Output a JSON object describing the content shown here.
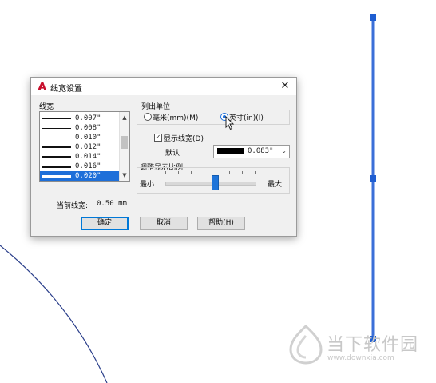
{
  "dialog": {
    "title": "线宽设置",
    "close_label": "✕",
    "lineweights_label": "线宽",
    "lineweights": [
      {
        "label": "0.007\"",
        "weight": 1
      },
      {
        "label": "0.008\"",
        "weight": 1
      },
      {
        "label": "0.010\"",
        "weight": 1
      },
      {
        "label": "0.012\"",
        "weight": 2
      },
      {
        "label": "0.014\"",
        "weight": 2
      },
      {
        "label": "0.016\"",
        "weight": 3
      },
      {
        "label": "0.020\"",
        "weight": 3,
        "selected": true
      }
    ],
    "units_group_label": "列出单位",
    "unit_mm_label": "毫米(mm)(M)",
    "unit_in_label": "英寸(in)(I)",
    "unit_selected": "in",
    "display_lineweight_label": "显示线宽(D)",
    "display_lineweight_checked": true,
    "default_label": "默认",
    "default_value": "0.083\"",
    "scale_group_label": "调整显示比例",
    "scale_min_label": "最小",
    "scale_max_label": "最大",
    "scale_value_fraction": 0.5,
    "current_lineweight_label": "当前线宽:",
    "current_lineweight_value": "0.50 mm",
    "ok_label": "确定",
    "cancel_label": "取消",
    "help_label": "帮助(H)"
  },
  "watermark": {
    "name": "当下软件园",
    "url": "www.downxia.com"
  },
  "colors": {
    "accent": "#1e6fd9",
    "canvas_line": "#3b6fd8",
    "grip": "#1f5ed1",
    "arc": "#2a3e8a"
  }
}
